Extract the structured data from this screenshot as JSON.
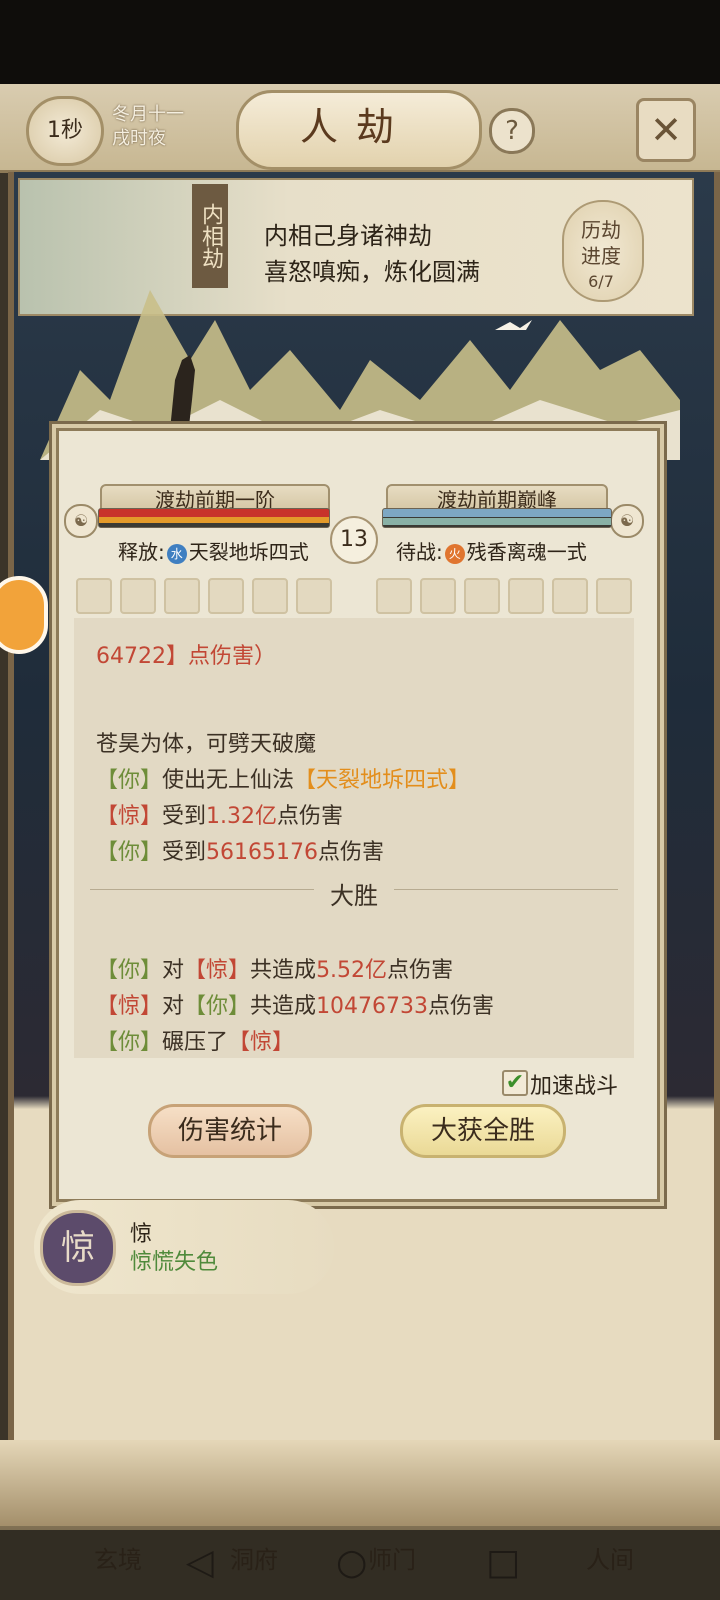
{
  "header": {
    "timer": "1秒",
    "date_line1": "冬月十一",
    "date_line2": "戌时夜",
    "title": "人劫",
    "help_label": "?",
    "close_label": "✕"
  },
  "trial": {
    "vertical_label": "内相劫",
    "line1": "内相己身诸神劫",
    "line2": "喜怒嗔痴，炼化圆满",
    "progress_label1": "历劫",
    "progress_label2": "进度",
    "progress_value": "6/7"
  },
  "battle": {
    "player_rank": "渡劫前期一阶",
    "enemy_rank": "渡劫前期巅峰",
    "round": "13",
    "player_skill_prefix": "释放:",
    "player_skill_elem": "水",
    "player_skill_name": "天裂地坼四式",
    "enemy_skill_prefix": "待战:",
    "enemy_skill_elem": "火",
    "enemy_skill_name": "残香离魂一式",
    "player_hp_fraction": 1.0,
    "enemy_hp_fraction": 1.0
  },
  "log": {
    "line_partial": "64722】点伤害）",
    "line_a": "苍昊为体，可劈天破魔",
    "line_b_who": "【你】",
    "line_b_text": "使出无上仙法",
    "line_b_skill": "【天裂地坼四式】",
    "line_c_who": "【惊】",
    "line_c_text1": "受到",
    "line_c_num": "1.32亿",
    "line_c_text2": "点伤害",
    "line_d_who": "【你】",
    "line_d_text1": "受到",
    "line_d_num": "56165176",
    "line_d_text2": "点伤害",
    "result": "大胜",
    "sum1_who": "【你】",
    "sum1_to": "对",
    "sum1_target": "【惊】",
    "sum1_text": "共造成",
    "sum1_num": "5.52亿",
    "sum1_end": "点伤害",
    "sum2_who": "【惊】",
    "sum2_to": "对",
    "sum2_target": "【你】",
    "sum2_text": "共造成",
    "sum2_num": "10476733",
    "sum2_end": "点伤害",
    "sum3_who": "【你】",
    "sum3_text": "碾压了",
    "sum3_target": "【惊】"
  },
  "controls": {
    "speed_label": "加速战斗",
    "speed_checked": true,
    "damage_btn": "伤害统计",
    "victory_btn": "大获全胜"
  },
  "enemy": {
    "avatar_char": "惊",
    "name": "惊",
    "state": "惊慌失色"
  },
  "nav": {
    "xuanjing": "玄境",
    "dongfu": "洞府",
    "shimen": "师门",
    "renjian": "人间"
  },
  "colors": {
    "ally_green": "#6e8d39",
    "enemy_red": "#c24735",
    "skill_orange": "#e38e1c"
  }
}
